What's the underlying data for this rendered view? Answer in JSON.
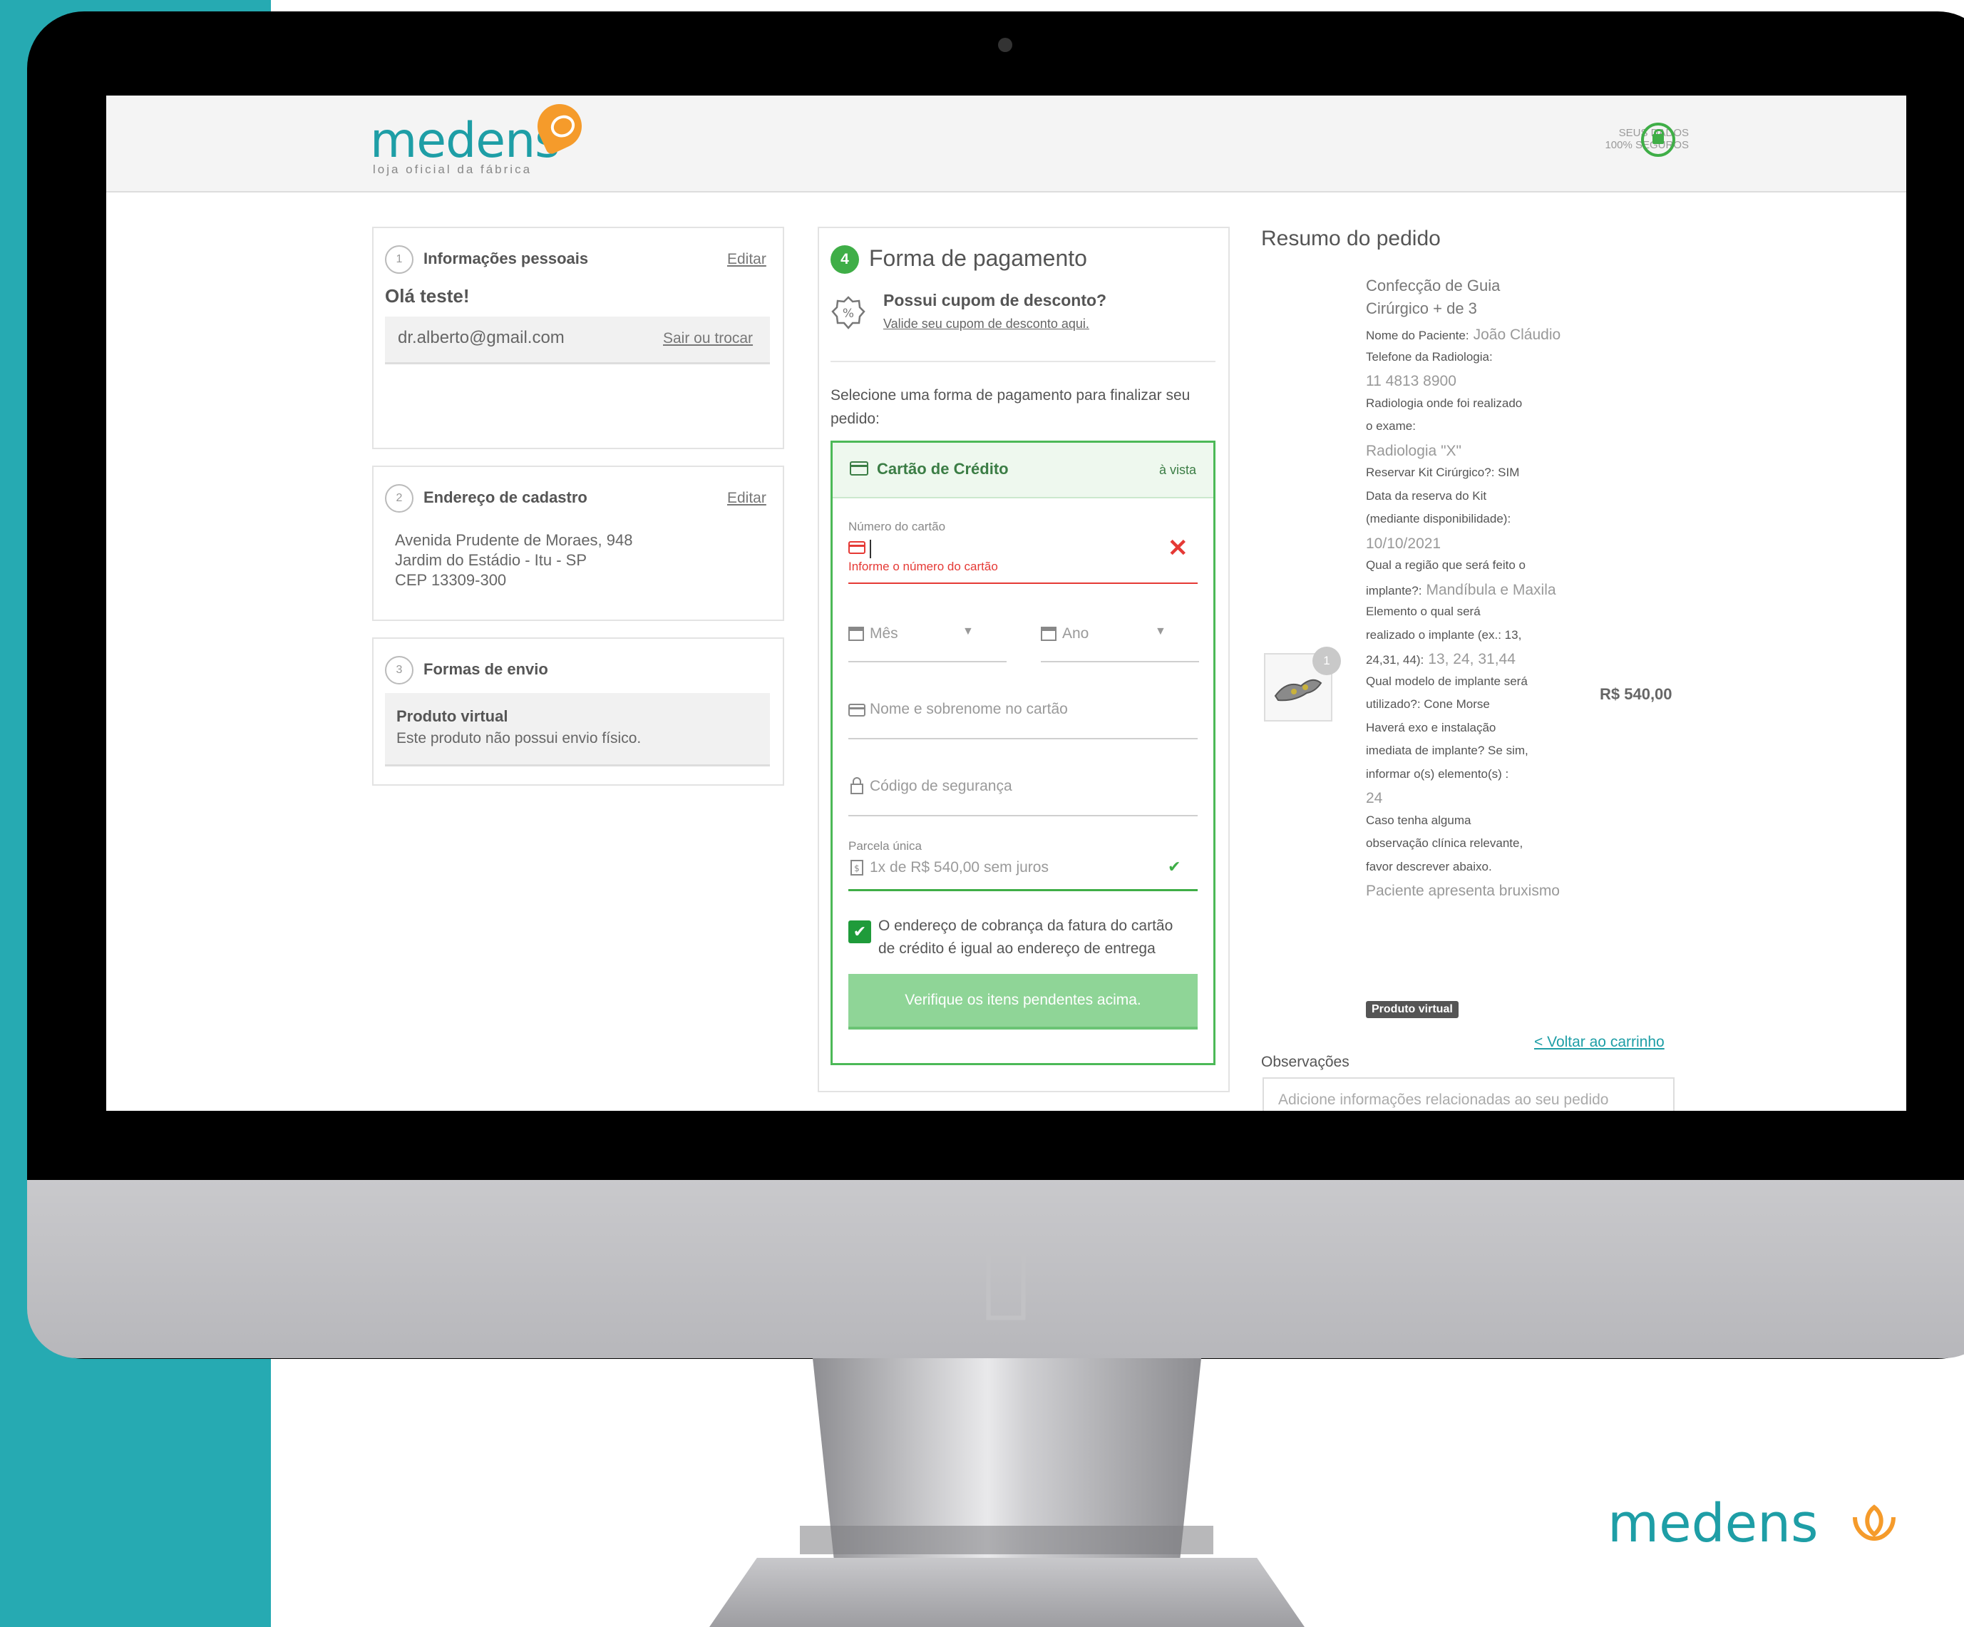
{
  "brand": {
    "logo_text": "medens",
    "logo_tagline": "loja oficial da fábrica",
    "secure_line1": "Seus dados",
    "secure_line2": "100% seguros",
    "footer_logo_text": "medens"
  },
  "personal": {
    "step": "1",
    "title": "Informações pessoais",
    "edit_label": "Editar",
    "greeting": "Olá teste!",
    "email": "dr.alberto@gmail.com",
    "switch_label": "Sair ou trocar"
  },
  "address": {
    "step": "2",
    "title": "Endereço de cadastro",
    "edit_label": "Editar",
    "line1": "Avenida Prudente de Moraes, 948",
    "line2": "Jardim do Estádio - Itu - SP",
    "line3": "CEP 13309-300"
  },
  "shipping": {
    "step": "3",
    "title": "Formas de envio",
    "option_title": "Produto virtual",
    "option_desc": "Este produto não possui envio físico."
  },
  "payment": {
    "step": "4",
    "title": "Forma de pagamento",
    "coupon_title": "Possui cupom de desconto?",
    "coupon_link": "Valide seu cupom de desconto aqui.",
    "instruction": "Selecione uma forma de pagamento para finalizar seu pedido:",
    "method_label": "Cartão de Crédito",
    "method_tag": "à vista",
    "card_number_label": "Número do cartão",
    "card_number_error": "Informe o número do cartão",
    "month_placeholder": "Mês",
    "year_placeholder": "Ano",
    "name_placeholder": "Nome e sobrenome no cartão",
    "cvv_placeholder": "Código de segurança",
    "installment_label": "Parcela única",
    "installment_value": "1x de R$ 540,00 sem juros",
    "billing_same_line1": "O endereço de cobrança da fatura do cartão",
    "billing_same_line2": "de crédito é igual ao endereço de entrega",
    "submit_label": "Verifique os itens pendentes acima."
  },
  "summary": {
    "title": "Resumo do pedido",
    "product_name_line1": "Confecção de Guia",
    "product_name_line2": "Cirúrgico + de 3",
    "quantity": "1",
    "price": "R$ 540,00",
    "details": [
      {
        "label": "Nome do Paciente:",
        "value": "João Cláudio"
      },
      {
        "label": "Telefone da Radiologia:",
        "value": ""
      },
      {
        "label": "",
        "value": "11 4813 8900"
      },
      {
        "label": "Radiologia onde foi realizado",
        "value": ""
      },
      {
        "label": "o exame:",
        "value": ""
      },
      {
        "label": "",
        "value": "Radiologia \"X\""
      },
      {
        "label": "Reservar Kit Cirúrgico?: SIM",
        "value": ""
      },
      {
        "label": "Data da reserva do Kit",
        "value": ""
      },
      {
        "label": "(mediante disponibilidade):",
        "value": ""
      },
      {
        "label": "",
        "value": "10/10/2021"
      },
      {
        "label": "Qual a região que será feito o",
        "value": ""
      },
      {
        "label": "implante?:",
        "value": "Mandíbula e Maxila"
      },
      {
        "label": "Elemento o qual será",
        "value": ""
      },
      {
        "label": "realizado o implante (ex.: 13,",
        "value": ""
      },
      {
        "label": "24,31, 44):",
        "value": "13, 24, 31,44"
      },
      {
        "label": "Qual modelo de implante será",
        "value": ""
      },
      {
        "label": "utilizado?: Cone Morse",
        "value": ""
      },
      {
        "label": "Haverá exo e instalação",
        "value": ""
      },
      {
        "label": "imediata de implante? Se sim,",
        "value": ""
      },
      {
        "label": "informar o(s) elemento(s) :",
        "value": ""
      },
      {
        "label": "",
        "value": "24"
      },
      {
        "label": "Caso tenha alguma",
        "value": ""
      },
      {
        "label": "observação clínica relevante,",
        "value": ""
      },
      {
        "label": "favor descrever abaixo.",
        "value": ""
      },
      {
        "label": "",
        "value": "Paciente apresenta bruxismo"
      }
    ],
    "product_badge": "Produto virtual",
    "back_link": "< Voltar ao carrinho",
    "notes_label": "Observações",
    "notes_placeholder": "Adicione informações relacionadas ao seu pedido"
  },
  "colors": {
    "accent_green": "#3fae47",
    "brand_teal": "#1e9ea6",
    "brand_orange": "#f59b2b",
    "error_red": "#e53935",
    "teal_band": "#26aab2"
  }
}
